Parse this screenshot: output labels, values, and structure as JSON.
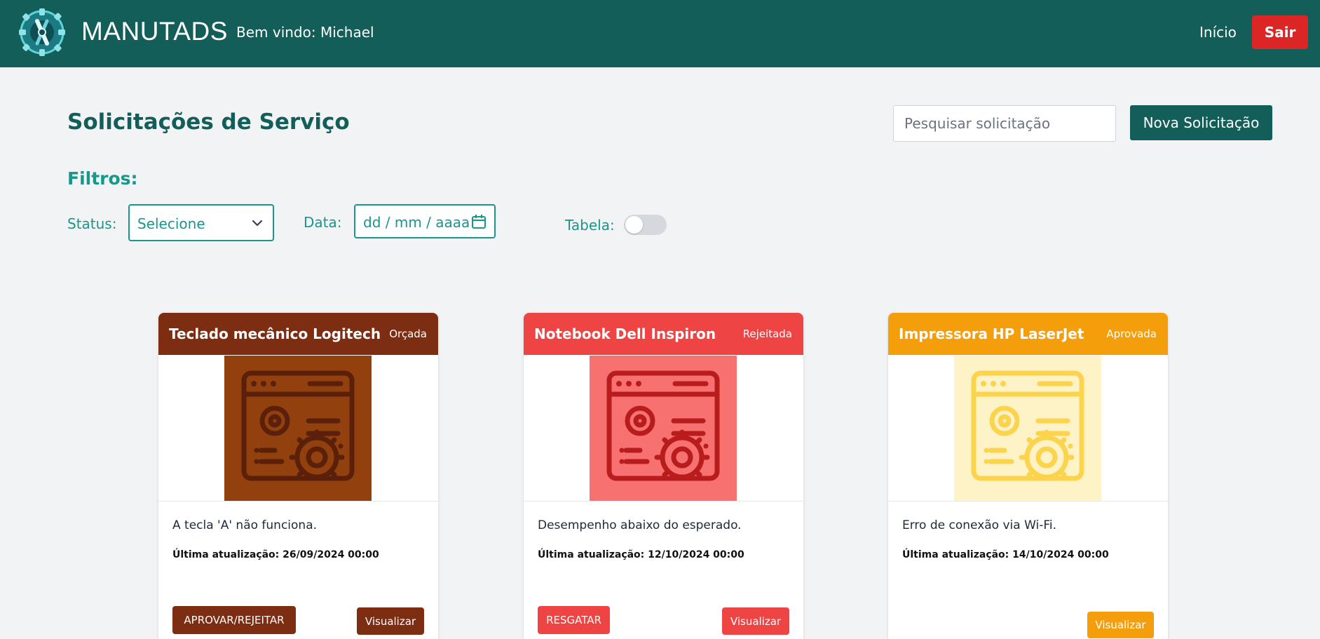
{
  "navbar": {
    "brand": "MANUTADS",
    "welcome": "Bem vindo: Michael",
    "home_link": "Início",
    "logout_label": "Sair"
  },
  "page": {
    "title": "Solicitações de Serviço",
    "search_placeholder": "Pesquisar solicitação",
    "new_button": "Nova Solicitação"
  },
  "filters": {
    "title": "Filtros:",
    "status_label": "Status:",
    "status_value": "Selecione",
    "date_label": "Data:",
    "date_value": "dd / mm / aaaa",
    "table_label": "Tabela:",
    "table_toggle_on": false
  },
  "cards": [
    {
      "title": "Teclado mecânico Logitech",
      "status": "Orçada",
      "description": "A tecla 'A' não funciona.",
      "updated": "Última atualização: 26/09/2024 00:00",
      "primary_action": "APROVAR/REJEITAR",
      "view_action": "Visualizar",
      "color": "#7c2d12"
    },
    {
      "title": "Notebook Dell Inspiron",
      "status": "Rejeitada",
      "description": "Desempenho abaixo do esperado.",
      "updated": "Última atualização: 12/10/2024 00:00",
      "primary_action": "RESGATAR",
      "view_action": "Visualizar",
      "color": "#ef4444"
    },
    {
      "title": "Impressora HP LaserJet",
      "status": "Aprovada",
      "description": "Erro de conexão via Wi-Fi.",
      "updated": "Última atualização: 14/10/2024 00:00",
      "view_action": "Visualizar",
      "color": "#f59e0b"
    }
  ],
  "colors": {
    "primary": "#135e59",
    "accent": "#18978a",
    "danger": "#dc2626",
    "background": "#f2f3f4"
  },
  "icons": [
    "logo-gear-wrench-icon",
    "chevron-down-icon",
    "calendar-icon",
    "settings-window-icon"
  ]
}
